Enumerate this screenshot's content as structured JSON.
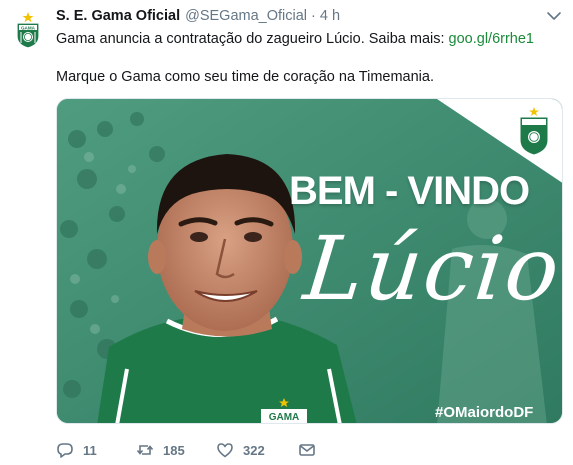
{
  "tweet": {
    "author_name": "S. E. Gama Oficial",
    "handle": "@SEGama_Oficial",
    "separator": "·",
    "time": "4 h",
    "text_line1": "Gama anuncia a contratação do zagueiro Lúcio. Saiba mais: ",
    "link": "goo.gl/6rrhe1",
    "text_line2": "Marque o Gama como seu time de coração na Timemania.",
    "avatar_icon": "gama-crest-icon",
    "caret_icon": "chevron-down-icon"
  },
  "media": {
    "headline": "BEM - VINDO",
    "player_name": "Lúcio",
    "hashtag": "#OMaiordoDF",
    "crest_text": "GAMA",
    "colors": {
      "background": "#3d8a6e",
      "jersey": "#1f7a4a",
      "star": "#f2c200"
    }
  },
  "actions": {
    "reply": {
      "icon": "reply-icon",
      "count": "11"
    },
    "retweet": {
      "icon": "retweet-icon",
      "count": "185"
    },
    "like": {
      "icon": "heart-icon",
      "count": "322"
    },
    "message": {
      "icon": "envelope-icon"
    }
  }
}
